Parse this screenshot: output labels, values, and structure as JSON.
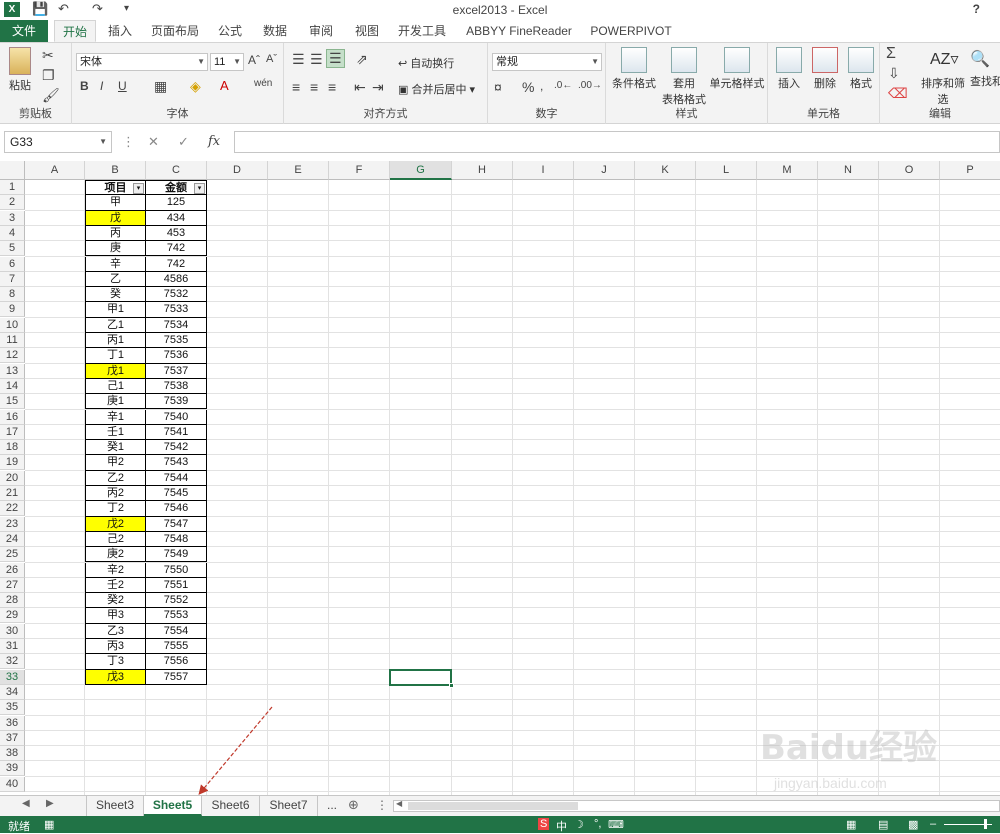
{
  "window": {
    "title": "excel2013 - Excel",
    "help": "?"
  },
  "tabs": [
    "文件",
    "开始",
    "插入",
    "页面布局",
    "公式",
    "数据",
    "审阅",
    "视图",
    "开发工具",
    "ABBYY FineReader 12",
    "POWERPIVOT"
  ],
  "ribbon": {
    "groups": {
      "clipboard": "剪贴板",
      "font": "字体",
      "align": "对齐方式",
      "number": "数字",
      "styles": "样式",
      "cells": "单元格",
      "edit": "编辑"
    },
    "paste": "粘贴",
    "font_name": "宋体",
    "font_size": "11",
    "wrap_text": "自动换行",
    "merge_center": "合并后居中",
    "number_format": "常规",
    "cond_format": "条件格式",
    "table_format_1": "套用",
    "table_format_2": "表格格式",
    "cell_styles": "单元格样式",
    "insert": "插入",
    "delete": "删除",
    "format": "格式",
    "sort_filter": "排序和筛选",
    "find_select": "查找和"
  },
  "formula_bar": {
    "name_box": "G33",
    "fx": "fx",
    "formula": ""
  },
  "columns": [
    "A",
    "B",
    "C",
    "D",
    "E",
    "F",
    "G",
    "H",
    "I",
    "J",
    "K",
    "L",
    "M",
    "N",
    "O",
    "P"
  ],
  "selected_column": "G",
  "selected_row": 33,
  "row_numbers": [
    "1",
    "2",
    "3",
    "4",
    "5",
    "6",
    "7",
    "8",
    "9",
    "10",
    "11",
    "12",
    "13",
    "14",
    "15",
    "16",
    "17",
    "18",
    "19",
    "20",
    "21",
    "22",
    "23",
    "24",
    "25",
    "26",
    "27",
    "28",
    "29",
    "30",
    "31",
    "32",
    "33",
    "34",
    "35",
    "36",
    "37",
    "38",
    "39",
    "40"
  ],
  "table": {
    "headers": [
      "项目",
      "金额"
    ],
    "rows": [
      {
        "item": "甲",
        "amount": "125",
        "highlight": false
      },
      {
        "item": "戊",
        "amount": "434",
        "highlight": true
      },
      {
        "item": "丙",
        "amount": "453",
        "highlight": false
      },
      {
        "item": "庚",
        "amount": "742",
        "highlight": false
      },
      {
        "item": "辛",
        "amount": "742",
        "highlight": false
      },
      {
        "item": "乙",
        "amount": "4586",
        "highlight": false
      },
      {
        "item": "癸",
        "amount": "7532",
        "highlight": false
      },
      {
        "item": "甲1",
        "amount": "7533",
        "highlight": false
      },
      {
        "item": "乙1",
        "amount": "7534",
        "highlight": false
      },
      {
        "item": "丙1",
        "amount": "7535",
        "highlight": false
      },
      {
        "item": "丁1",
        "amount": "7536",
        "highlight": false
      },
      {
        "item": "戊1",
        "amount": "7537",
        "highlight": true
      },
      {
        "item": "己1",
        "amount": "7538",
        "highlight": false
      },
      {
        "item": "庚1",
        "amount": "7539",
        "highlight": false
      },
      {
        "item": "辛1",
        "amount": "7540",
        "highlight": false
      },
      {
        "item": "壬1",
        "amount": "7541",
        "highlight": false
      },
      {
        "item": "癸1",
        "amount": "7542",
        "highlight": false
      },
      {
        "item": "甲2",
        "amount": "7543",
        "highlight": false
      },
      {
        "item": "乙2",
        "amount": "7544",
        "highlight": false
      },
      {
        "item": "丙2",
        "amount": "7545",
        "highlight": false
      },
      {
        "item": "丁2",
        "amount": "7546",
        "highlight": false
      },
      {
        "item": "戊2",
        "amount": "7547",
        "highlight": true
      },
      {
        "item": "己2",
        "amount": "7548",
        "highlight": false
      },
      {
        "item": "庚2",
        "amount": "7549",
        "highlight": false
      },
      {
        "item": "辛2",
        "amount": "7550",
        "highlight": false
      },
      {
        "item": "壬2",
        "amount": "7551",
        "highlight": false
      },
      {
        "item": "癸2",
        "amount": "7552",
        "highlight": false
      },
      {
        "item": "甲3",
        "amount": "7553",
        "highlight": false
      },
      {
        "item": "乙3",
        "amount": "7554",
        "highlight": false
      },
      {
        "item": "丙3",
        "amount": "7555",
        "highlight": false
      },
      {
        "item": "丁3",
        "amount": "7556",
        "highlight": false
      },
      {
        "item": "戊3",
        "amount": "7557",
        "highlight": true
      }
    ]
  },
  "sheets": [
    "Sheet3",
    "Sheet5",
    "Sheet6",
    "Sheet7"
  ],
  "active_sheet": "Sheet5",
  "sheet_more": "...",
  "status": {
    "ready": "就绪",
    "ime": "中"
  },
  "watermark": {
    "brand": "Baidu经验",
    "url": "jingyan.baidu.com"
  },
  "colors": {
    "excel_green": "#217346",
    "highlight": "#ffff00",
    "arrow": "#c0392b"
  }
}
